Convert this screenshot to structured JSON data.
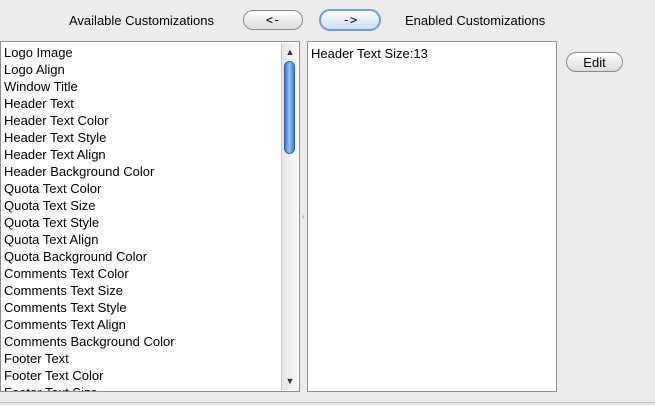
{
  "labels": {
    "available": "Available Customizations",
    "enabled": "Enabled Customizations"
  },
  "buttons": {
    "move_left": "<-",
    "move_right": "->",
    "edit": "Edit"
  },
  "available_items": [
    "Logo Image",
    "Logo Align",
    "Window Title",
    "Header Text",
    "Header Text Color",
    "Header Text Style",
    "Header Text Align",
    "Header Background Color",
    "Quota Text Color",
    "Quota Text Size",
    "Quota Text Style",
    "Quota Text Align",
    "Quota Background Color",
    "Comments Text Color",
    "Comments Text Size",
    "Comments Text Style",
    "Comments Text Align",
    "Comments Background Color",
    "Footer Text",
    "Footer Text Color",
    "Footer Text Size"
  ],
  "enabled_items": [
    "Header Text Size:13"
  ],
  "icons": {
    "scroll_up": "▲",
    "scroll_down": "▼",
    "split_grip": "‹"
  },
  "colors": {
    "accent": "#3a79d4"
  }
}
